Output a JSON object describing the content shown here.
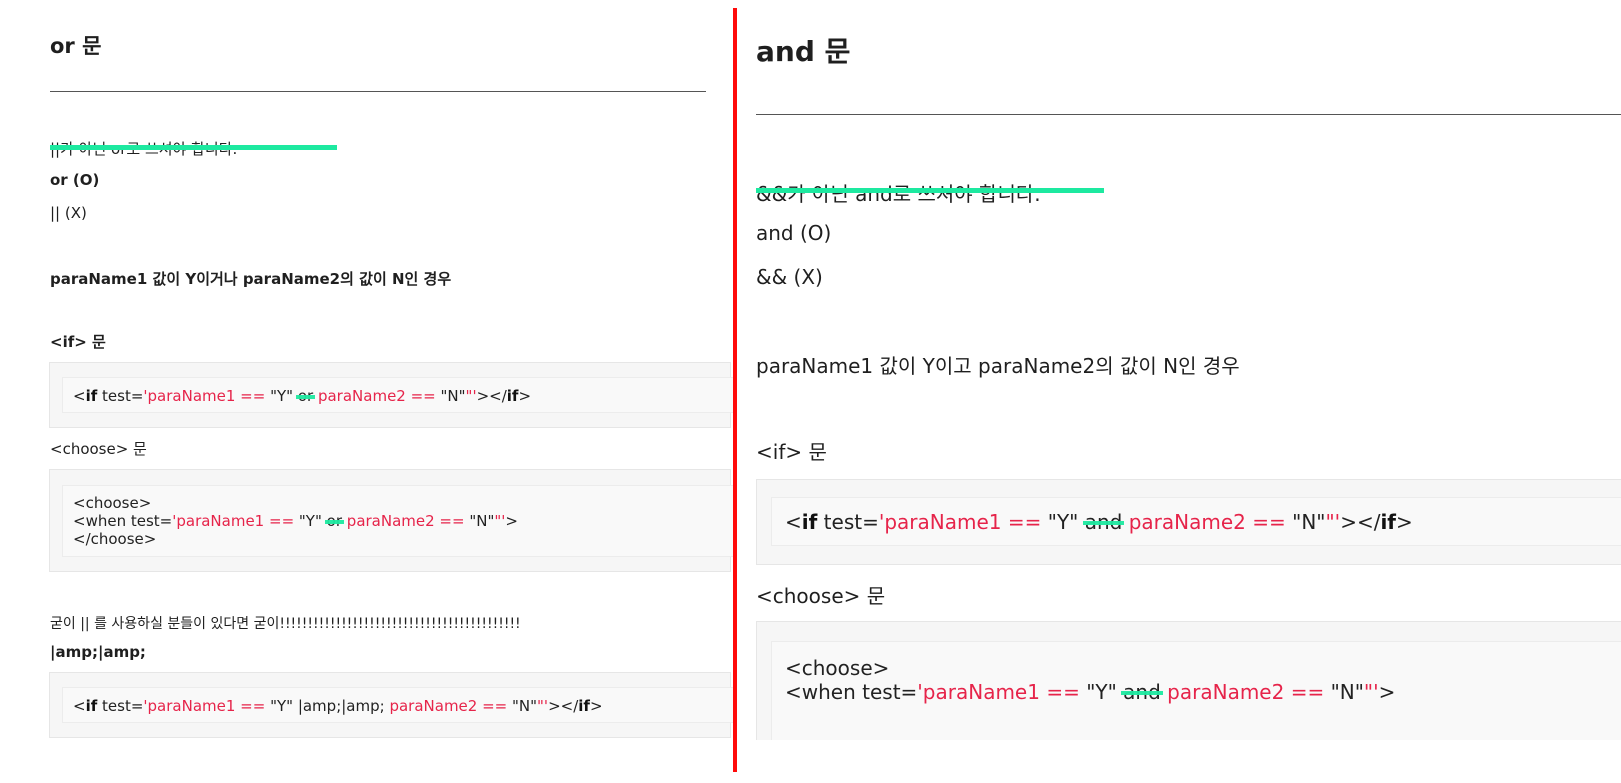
{
  "left": {
    "title": "or 문",
    "highlighted_note": "||가 아닌 or로 쓰셔야 합니다.",
    "correct": "or (O)",
    "wrong": "|| (X)",
    "case": "paraName1 값이 Y이거나 paraName2의 값이 N인 경우",
    "if_heading": "<if> 문",
    "if_code": {
      "open": "<",
      "tag": "if",
      "attr": " test=",
      "q1": "'",
      "s1": "paraName1 == ",
      "v1": "\"Y\"",
      "op": "or",
      "s2": "paraName2 == ",
      "v2": "\"N\"",
      "q2": "\"'",
      "close": "></",
      "endtag": "if",
      "end": ">"
    },
    "choose_heading": "<choose> 문",
    "choose_code": {
      "line1": "<choose>",
      "line2_pre": "<when test=",
      "q1": "'",
      "s1": "paraName1 == ",
      "v1": "\"Y\"",
      "op": "or",
      "s2": "paraName2 == ",
      "v2": "\"N\"",
      "q2": "\"'",
      "end": ">",
      "line3": "</choose>"
    },
    "remark": "굳이 || 를 사용하실 분들이 있다면 굳이!!!!!!!!!!!!!!!!!!!!!!!!!!!!!!!!!!!!!!!!!!!",
    "amp": "|amp;|amp;",
    "amp_code": {
      "open": "<",
      "tag": "if",
      "attr": " test=",
      "q1": "'",
      "s1": "paraName1 == ",
      "v1": "\"Y\"",
      "op": " |amp;|amp; ",
      "s2": "paraName2 == ",
      "v2": "\"N\"",
      "q2": "\"'",
      "close": "></",
      "endtag": "if",
      "end": ">"
    }
  },
  "right": {
    "title": "and 문",
    "highlighted_note": "&&가 아닌 and로 쓰셔야 합니다.",
    "correct": "and (O)",
    "wrong": "&& (X)",
    "case": "paraName1 값이 Y이고 paraName2의 값이 N인 경우",
    "if_heading": "<if> 문",
    "if_code": {
      "open": "<",
      "tag": "if",
      "attr": " test=",
      "q1": "'",
      "s1": "paraName1 == ",
      "v1": "\"Y\"",
      "op": "and",
      "s2": "paraName2 == ",
      "v2": "\"N\"",
      "q2": "\"'",
      "close": "></",
      "endtag": "if",
      "end": ">"
    },
    "choose_heading": "<choose> 문",
    "choose_code": {
      "line1": "<choose>",
      "line2_pre": "<when test=",
      "q1": "'",
      "s1": "paraName1 == ",
      "v1": "\"Y\"",
      "op": "and",
      "s2": "paraName2 == ",
      "v2": "\"N\"",
      "q2": "\"'",
      "end": ">"
    }
  },
  "colors": {
    "divider": "#ff0a0a",
    "highlight": "#1de9a0",
    "string": "#e6244a"
  }
}
